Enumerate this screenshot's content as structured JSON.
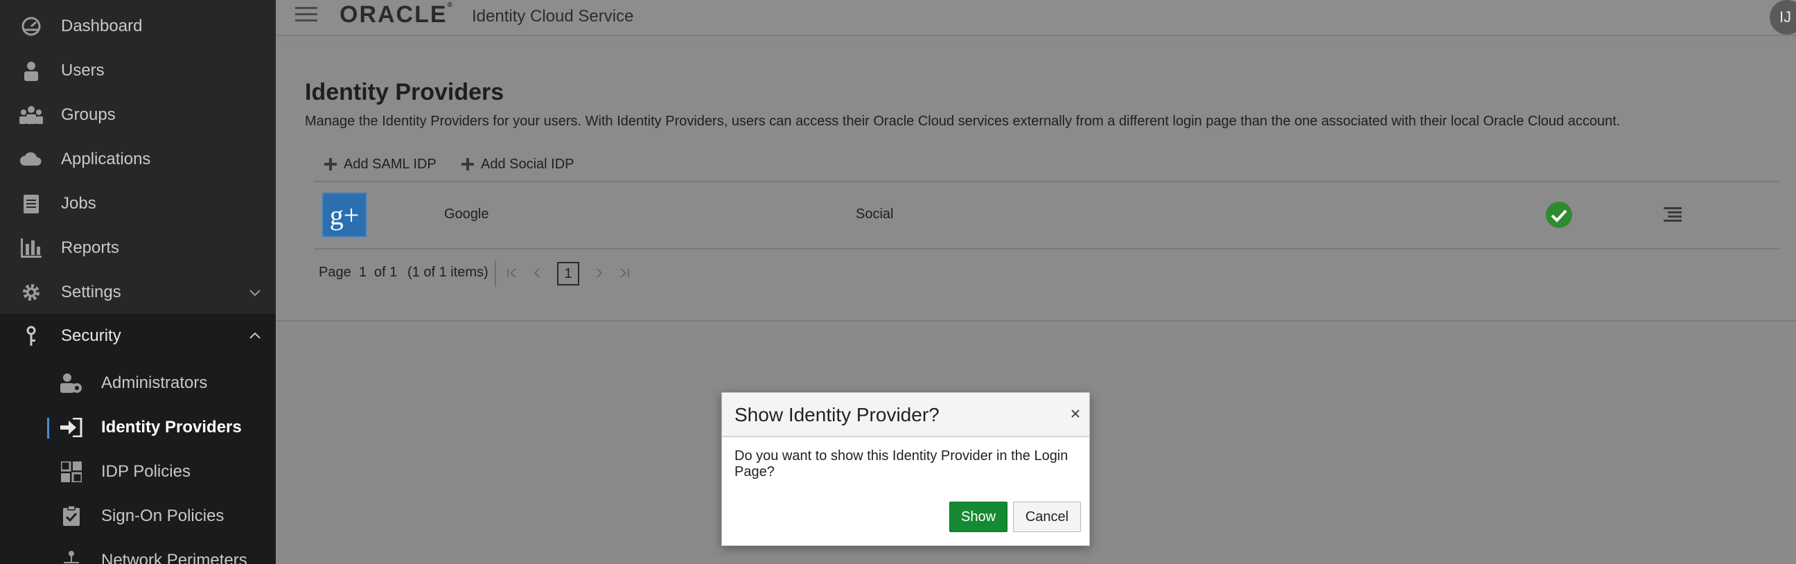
{
  "sidebar": {
    "items": [
      {
        "label": "Dashboard",
        "icon": "dashboard-icon"
      },
      {
        "label": "Users",
        "icon": "user-icon"
      },
      {
        "label": "Groups",
        "icon": "groups-icon"
      },
      {
        "label": "Applications",
        "icon": "cloud-icon"
      },
      {
        "label": "Jobs",
        "icon": "jobs-icon"
      },
      {
        "label": "Reports",
        "icon": "reports-icon"
      },
      {
        "label": "Settings",
        "icon": "gear-icon"
      },
      {
        "label": "Security",
        "icon": "key-icon"
      }
    ],
    "security_items": [
      {
        "label": "Administrators",
        "icon": "admin-icon"
      },
      {
        "label": "Identity Providers",
        "icon": "sign-in-icon"
      },
      {
        "label": "IDP Policies",
        "icon": "idp-policies-icon"
      },
      {
        "label": "Sign-On Policies",
        "icon": "clipboard-check-icon"
      },
      {
        "label": "Network Perimeters",
        "icon": "network-icon"
      }
    ]
  },
  "header": {
    "logo": "ORACLE",
    "logo_mark": "®",
    "service_title": "Identity Cloud Service",
    "avatar_initials": "IJ"
  },
  "main": {
    "title": "Identity Providers",
    "description": "Manage the Identity Providers for your users. With Identity Providers, users can access their Oracle Cloud services externally from a different login page than the one associated with their local Oracle Cloud account.",
    "add_saml_label": "Add SAML IDP",
    "add_social_label": "Add Social IDP",
    "rows": [
      {
        "logo_text": "g+",
        "name": "Google",
        "type": "Social",
        "enabled": true
      }
    ],
    "pager": {
      "page_label": "Page",
      "page_num": "1",
      "of_label": "of 1",
      "items_label": "(1 of 1 items)",
      "current_page": "1"
    }
  },
  "modal": {
    "title": "Show Identity Provider?",
    "close": "×",
    "message": "Do you want to show this Identity Provider in the Login Page?",
    "show_label": "Show",
    "cancel_label": "Cancel"
  },
  "colors": {
    "sidebar_bg": "#252728",
    "overlay": "#8b8b8b",
    "show_button": "#158a32",
    "check": "#2e8b2e",
    "google_blue": "#2b6fb0"
  }
}
